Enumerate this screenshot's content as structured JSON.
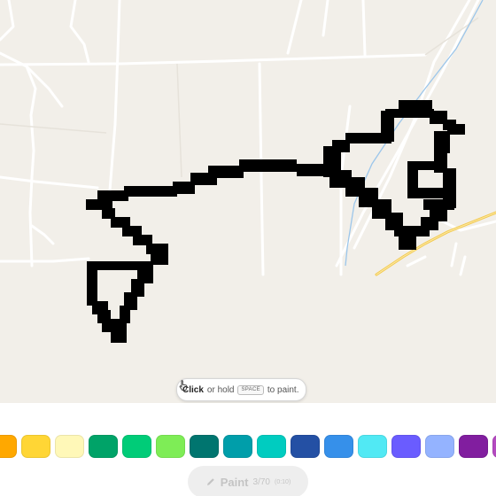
{
  "hint": {
    "action": "Click",
    "or_hold": "or hold",
    "key": "SPACE",
    "suffix": "to paint."
  },
  "paint_button": {
    "label": "Paint",
    "count": "3/70",
    "timer": "(0:10)"
  },
  "palette": [
    {
      "name": "orange",
      "color": "#ffa800"
    },
    {
      "name": "yellow",
      "color": "#ffd635"
    },
    {
      "name": "pale-yellow",
      "color": "#fff8b8"
    },
    {
      "name": "dark-green",
      "color": "#00a368"
    },
    {
      "name": "green",
      "color": "#00cc78"
    },
    {
      "name": "light-green",
      "color": "#7eed56"
    },
    {
      "name": "dark-teal",
      "color": "#00756f"
    },
    {
      "name": "teal",
      "color": "#009eaa"
    },
    {
      "name": "light-teal",
      "color": "#00ccc0"
    },
    {
      "name": "dark-blue",
      "color": "#2450a4"
    },
    {
      "name": "blue",
      "color": "#3690ea"
    },
    {
      "name": "light-blue",
      "color": "#51e9f4"
    },
    {
      "name": "indigo",
      "color": "#6a5cff"
    },
    {
      "name": "periwinkle",
      "color": "#94b3ff"
    },
    {
      "name": "dark-purple",
      "color": "#811e9f"
    },
    {
      "name": "purple",
      "color": "#b44ac0"
    }
  ]
}
